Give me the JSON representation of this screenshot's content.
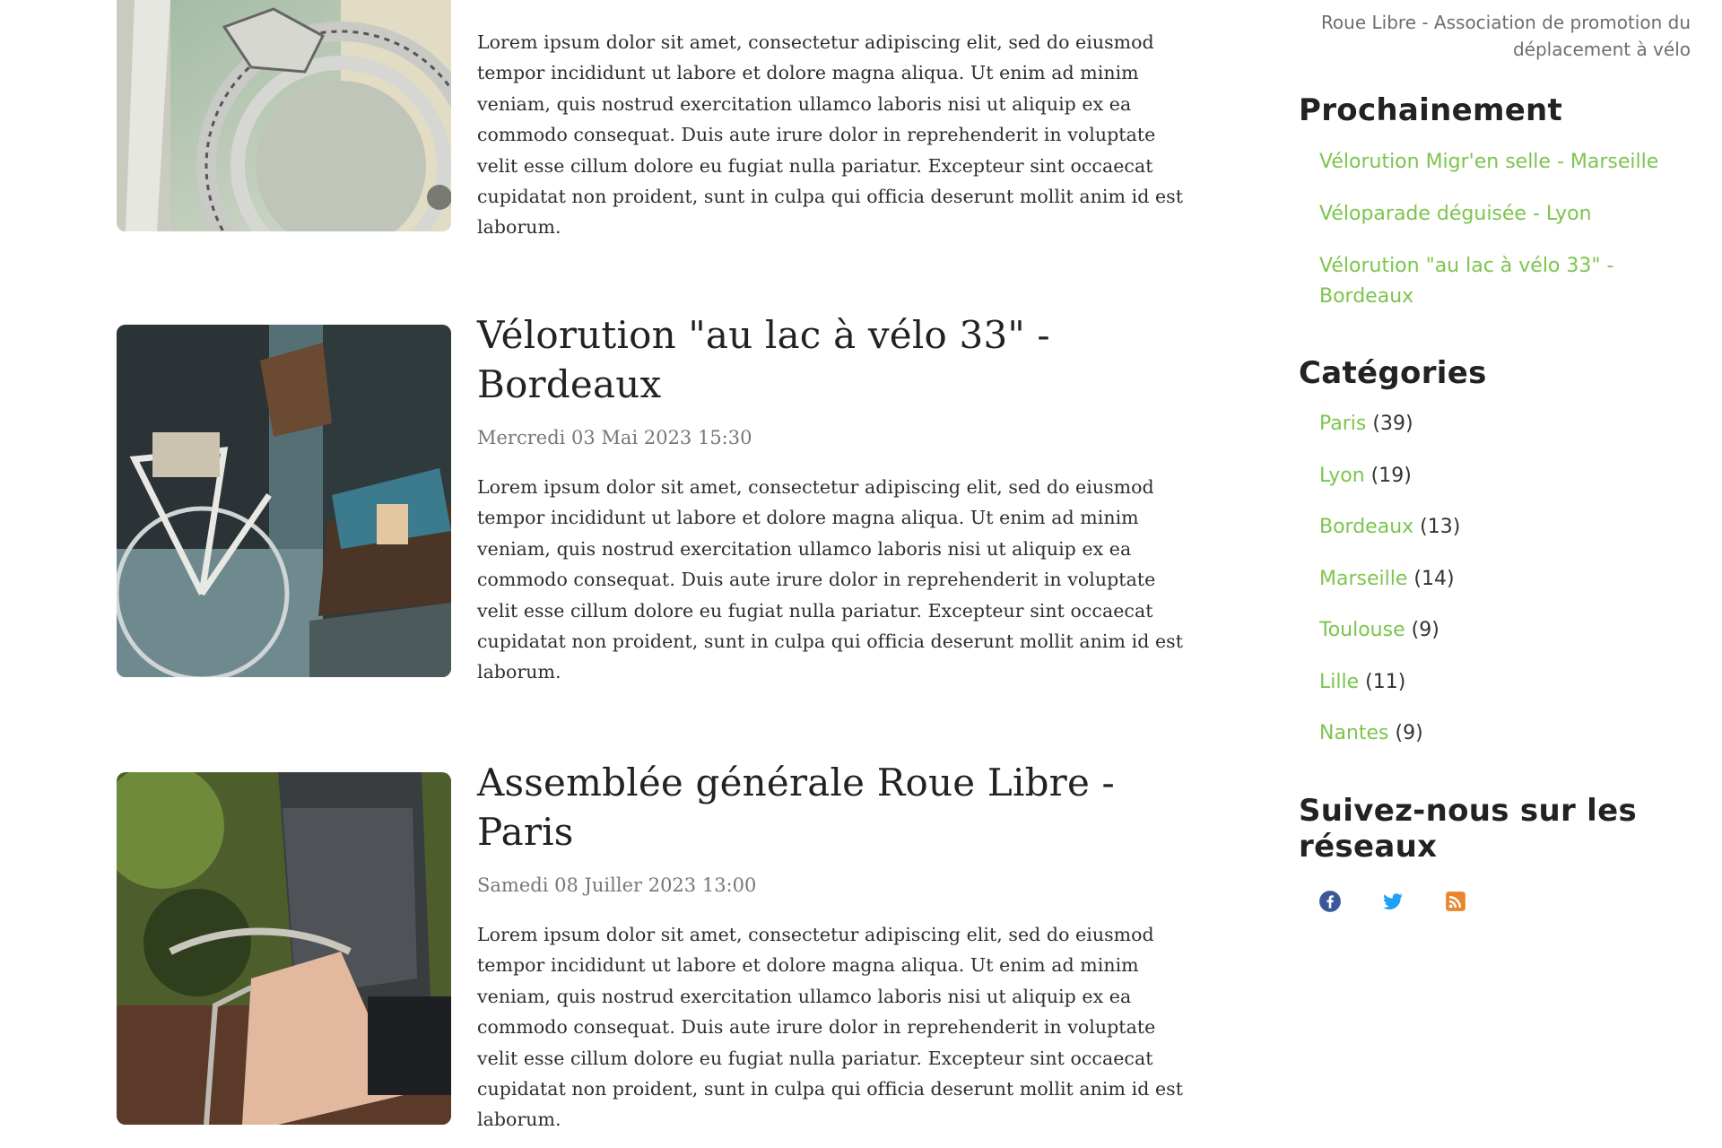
{
  "articles": [
    {
      "title": "",
      "date": "",
      "body": "Lorem ipsum dolor sit amet, consectetur adipiscing elit, sed do eiusmod tempor incididunt ut labore et dolore magna aliqua. Ut enim ad minim veniam, quis nostrud exercitation ullamco laboris nisi ut aliquip ex ea commodo consequat. Duis aute irure dolor in reprehenderit in voluptate velit esse cillum dolore eu fugiat nulla pariatur. Excepteur sint occaecat cupidatat non proident, sunt in culpa qui officia deserunt mollit anim id est laborum.",
      "image": "bicycle-chainring-photo"
    },
    {
      "title": "Vélorution \"au lac à vélo 33\" - Bordeaux",
      "date": "Mercredi 03 Mai 2023 15:30",
      "body": "Lorem ipsum dolor sit amet, consectetur adipiscing elit, sed do eiusmod tempor incididunt ut labore et dolore magna aliqua. Ut enim ad minim veniam, quis nostrud exercitation ullamco laboris nisi ut aliquip ex ea commodo consequat. Duis aute irure dolor in reprehenderit in voluptate velit esse cillum dolore eu fugiat nulla pariatur. Excepteur sint occaecat cupidatat non proident, sunt in culpa qui officia deserunt mollit anim id est laborum.",
      "image": "vintage-bicycle-shop-photo"
    },
    {
      "title": "Assemblée générale Roue Libre - Paris",
      "date": "Samedi 08 Juiller 2023 13:00",
      "body": "Lorem ipsum dolor sit amet, consectetur adipiscing elit, sed do eiusmod tempor incididunt ut labore et dolore magna aliqua. Ut enim ad minim veniam, quis nostrud exercitation ullamco laboris nisi ut aliquip ex ea commodo consequat. Duis aute irure dolor in reprehenderit in voluptate velit esse cillum dolore eu fugiat nulla pariatur. Excepteur sint occaecat cupidatat non proident, sunt in culpa qui officia deserunt mollit anim id est laborum.",
      "image": "woman-riding-bicycle-photo"
    }
  ],
  "sidebar": {
    "tagline": "Roue Libre - Association de promotion du déplacement à vélo",
    "upcoming_heading": "Prochainement",
    "upcoming": [
      "Vélorution Migr'en selle - Marseille",
      "Véloparade déguisée - Lyon",
      "Vélorution \"au lac à vélo 33\" - Bordeaux"
    ],
    "categories_heading": "Catégories",
    "categories": [
      {
        "name": "Paris",
        "count": "(39)"
      },
      {
        "name": "Lyon",
        "count": "(19)"
      },
      {
        "name": "Bordeaux",
        "count": "(13)"
      },
      {
        "name": "Marseille",
        "count": "(14)"
      },
      {
        "name": "Toulouse",
        "count": "(9)"
      },
      {
        "name": "Lille",
        "count": "(11)"
      },
      {
        "name": "Nantes",
        "count": "(9)"
      }
    ],
    "social_heading": "Suivez-nous sur les réseaux",
    "social": [
      "facebook-icon",
      "twitter-icon",
      "rss-icon"
    ]
  },
  "colors": {
    "link": "#7cc44e",
    "facebook": "#3b5998",
    "twitter": "#1da1f2",
    "rss": "#e8862c"
  }
}
